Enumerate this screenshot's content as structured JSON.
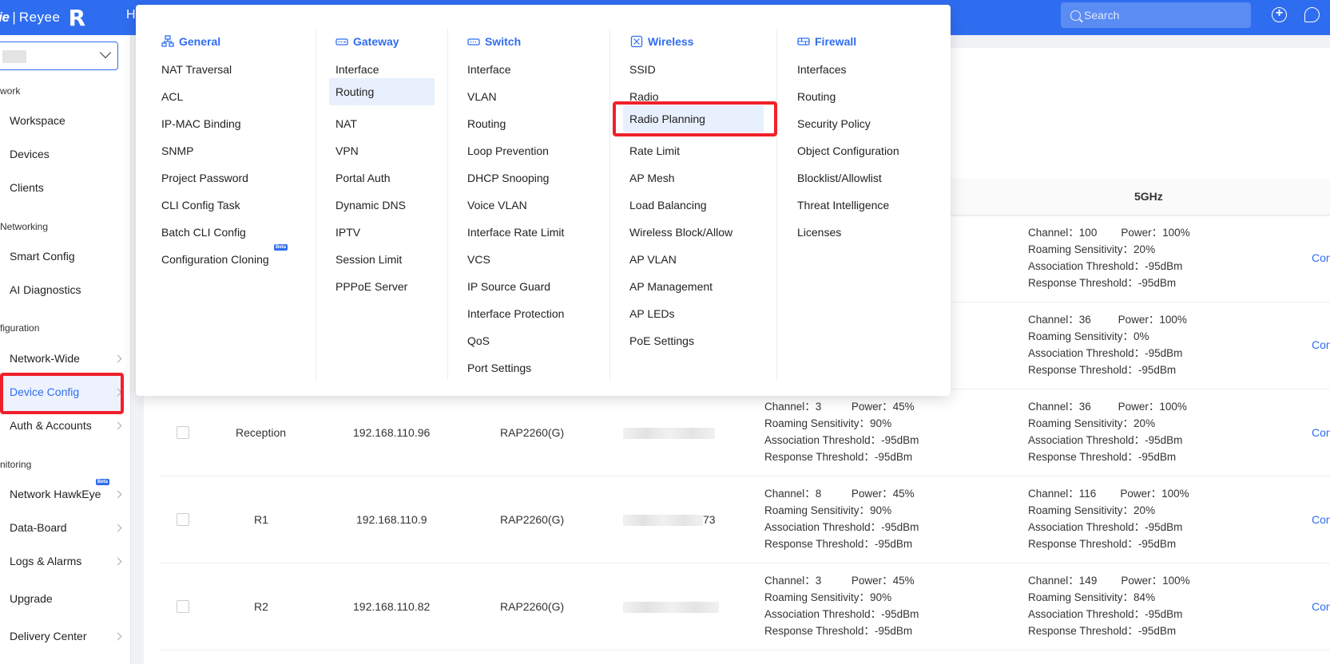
{
  "topbar": {
    "brand_ruijie": "jie",
    "brand_reyee": "Reyee",
    "brand_mark": "R",
    "nav_partial": "H",
    "search_placeholder": "Search"
  },
  "sidebar": {
    "sections": [
      {
        "label": "work"
      },
      {
        "label": "Networking"
      },
      {
        "label": "figuration"
      },
      {
        "label": "nitoring"
      }
    ],
    "items": [
      {
        "label": "Workspace"
      },
      {
        "label": "Devices"
      },
      {
        "label": "Clients"
      },
      {
        "label": "Smart Config"
      },
      {
        "label": "AI Diagnostics"
      },
      {
        "label": "Network-Wide"
      },
      {
        "label": "Device Config"
      },
      {
        "label": "Auth & Accounts"
      },
      {
        "label": "Network HawkEye"
      },
      {
        "label": "Data-Board"
      },
      {
        "label": "Logs & Alarms"
      },
      {
        "label": "Upgrade"
      },
      {
        "label": "Delivery Center"
      }
    ],
    "beta_label": "Beta"
  },
  "menu": {
    "general": {
      "title": "General",
      "items": [
        "NAT Traversal",
        "ACL",
        "IP-MAC Binding",
        "SNMP",
        "Project Password",
        "CLI Config Task",
        "Batch CLI Config",
        "Configuration Cloning"
      ]
    },
    "gateway": {
      "title": "Gateway",
      "items": [
        "Interface",
        "Routing",
        "NAT",
        "VPN",
        "Portal Auth",
        "Dynamic DNS",
        "IPTV",
        "Session Limit",
        "PPPoE Server"
      ]
    },
    "switch": {
      "title": "Switch",
      "items": [
        "Interface",
        "VLAN",
        "Routing",
        "Loop Prevention",
        "DHCP Snooping",
        "Voice VLAN",
        "Interface Rate Limit",
        "VCS",
        "IP Source Guard",
        "Interface Protection",
        "QoS",
        "Port Settings"
      ]
    },
    "wireless": {
      "title": "Wireless",
      "items": [
        "SSID",
        "Radio",
        "Radio Planning",
        "Rate Limit",
        "AP Mesh",
        "Load Balancing",
        "Wireless Block/Allow",
        "AP VLAN",
        "AP Management",
        "AP LEDs",
        "PoE Settings"
      ]
    },
    "firewall": {
      "title": "Firewall",
      "items": [
        "Interfaces",
        "Routing",
        "Security Policy",
        "Object Configuration",
        "Blocklist/Allowlist",
        "Threat Intelligence",
        "Licenses"
      ]
    }
  },
  "table": {
    "header_5g": "5GHz",
    "op_label": "Con",
    "rows": [
      {
        "name": "",
        "ip": "",
        "model": "",
        "sn_tail": "",
        "g24": null,
        "g5": {
          "channel": "100",
          "power": "100%",
          "roaming": "20%",
          "assoc": "-95dBm",
          "resp": "-95dBm"
        }
      },
      {
        "name": "",
        "ip": "",
        "model": "",
        "sn_tail": "",
        "g24": null,
        "g5": {
          "channel": "36",
          "power": "100%",
          "roaming": "0%",
          "assoc": "-95dBm",
          "resp": "-95dBm"
        }
      },
      {
        "name": "Reception",
        "ip": "192.168.110.96",
        "model": "RAP2260(G)",
        "sn_tail": "",
        "g24": {
          "channel": "3",
          "power": "45%",
          "roaming": "90%",
          "assoc": "-95dBm",
          "resp": "-95dBm"
        },
        "g5": {
          "channel": "36",
          "power": "100%",
          "roaming": "20%",
          "assoc": "-95dBm",
          "resp": "-95dBm"
        }
      },
      {
        "name": "R1",
        "ip": "192.168.110.9",
        "model": "RAP2260(G)",
        "sn_tail": "73",
        "g24": {
          "channel": "8",
          "power": "45%",
          "roaming": "90%",
          "assoc": "-95dBm",
          "resp": "-95dBm"
        },
        "g5": {
          "channel": "116",
          "power": "100%",
          "roaming": "20%",
          "assoc": "-95dBm",
          "resp": "-95dBm"
        }
      },
      {
        "name": "R2",
        "ip": "192.168.110.82",
        "model": "RAP2260(G)",
        "sn_tail": "",
        "g24": {
          "channel": "3",
          "power": "45%",
          "roaming": "90%",
          "assoc": "-95dBm",
          "resp": "-95dBm"
        },
        "g5": {
          "channel": "149",
          "power": "100%",
          "roaming": "84%",
          "assoc": "-95dBm",
          "resp": "-95dBm"
        }
      }
    ],
    "labels": {
      "channel": "Channel：",
      "power": "Power：",
      "roaming": "Roaming Sensitivity：",
      "assoc": "Association Threshold：",
      "resp": "Response Threshold："
    }
  },
  "colors": {
    "brand": "#2f6df0",
    "highlight_box": "#f0202a"
  }
}
